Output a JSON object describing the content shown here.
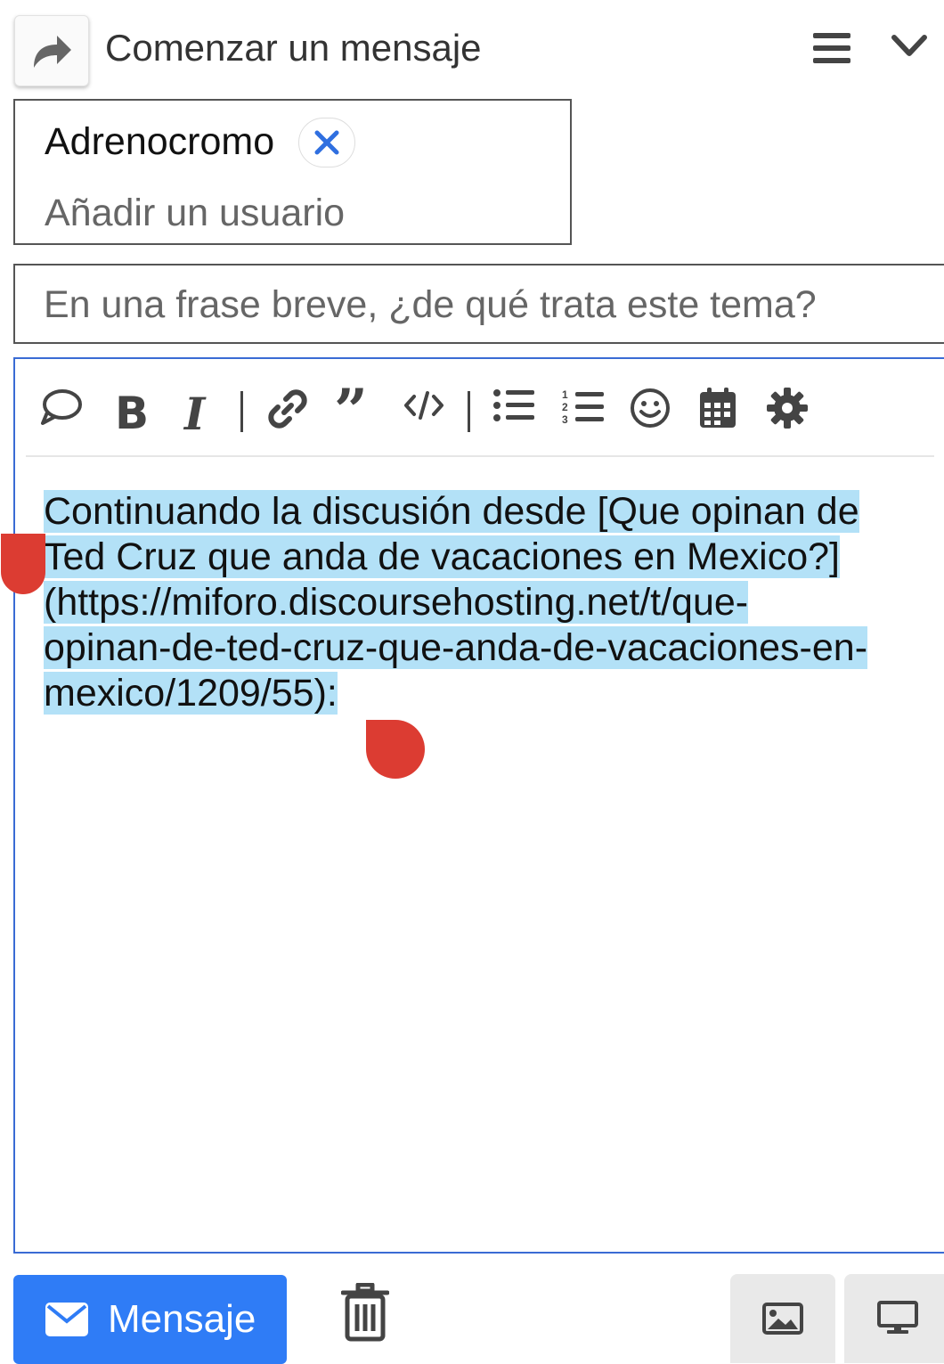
{
  "header": {
    "title": "Comenzar un mensaje",
    "icons": [
      "reply-icon",
      "hamburger-menu-icon",
      "chevron-down-icon"
    ]
  },
  "recipients": {
    "chips": [
      {
        "label": "Adrenocromo"
      }
    ],
    "placeholder": "Añadir un usuario"
  },
  "subject": {
    "placeholder": "En una frase breve, ¿de qué trata este tema?"
  },
  "toolbar": {
    "icons": [
      "quote-bubble-icon",
      "bold-icon",
      "italic-icon",
      "link-icon",
      "blockquote-icon",
      "code-icon",
      "bullet-list-icon",
      "numbered-list-icon",
      "emoji-icon",
      "calendar-icon",
      "gear-icon"
    ]
  },
  "editor": {
    "lines": [
      "Continuando la discusión desde [Que opinan de ",
      "Ted Cruz que anda de vacaciones en Mexico?]",
      "(https://miforo.discoursehosting.net/t/que-",
      "opinan-de-ted-cruz-que-anda-de-vacaciones-en-",
      "mexico/1209/55):"
    ],
    "selection_color": "#b3e1f7",
    "handle_color": "#dc3c32"
  },
  "footer": {
    "send_label": "Mensaje",
    "accent": "#2f7cf6"
  }
}
